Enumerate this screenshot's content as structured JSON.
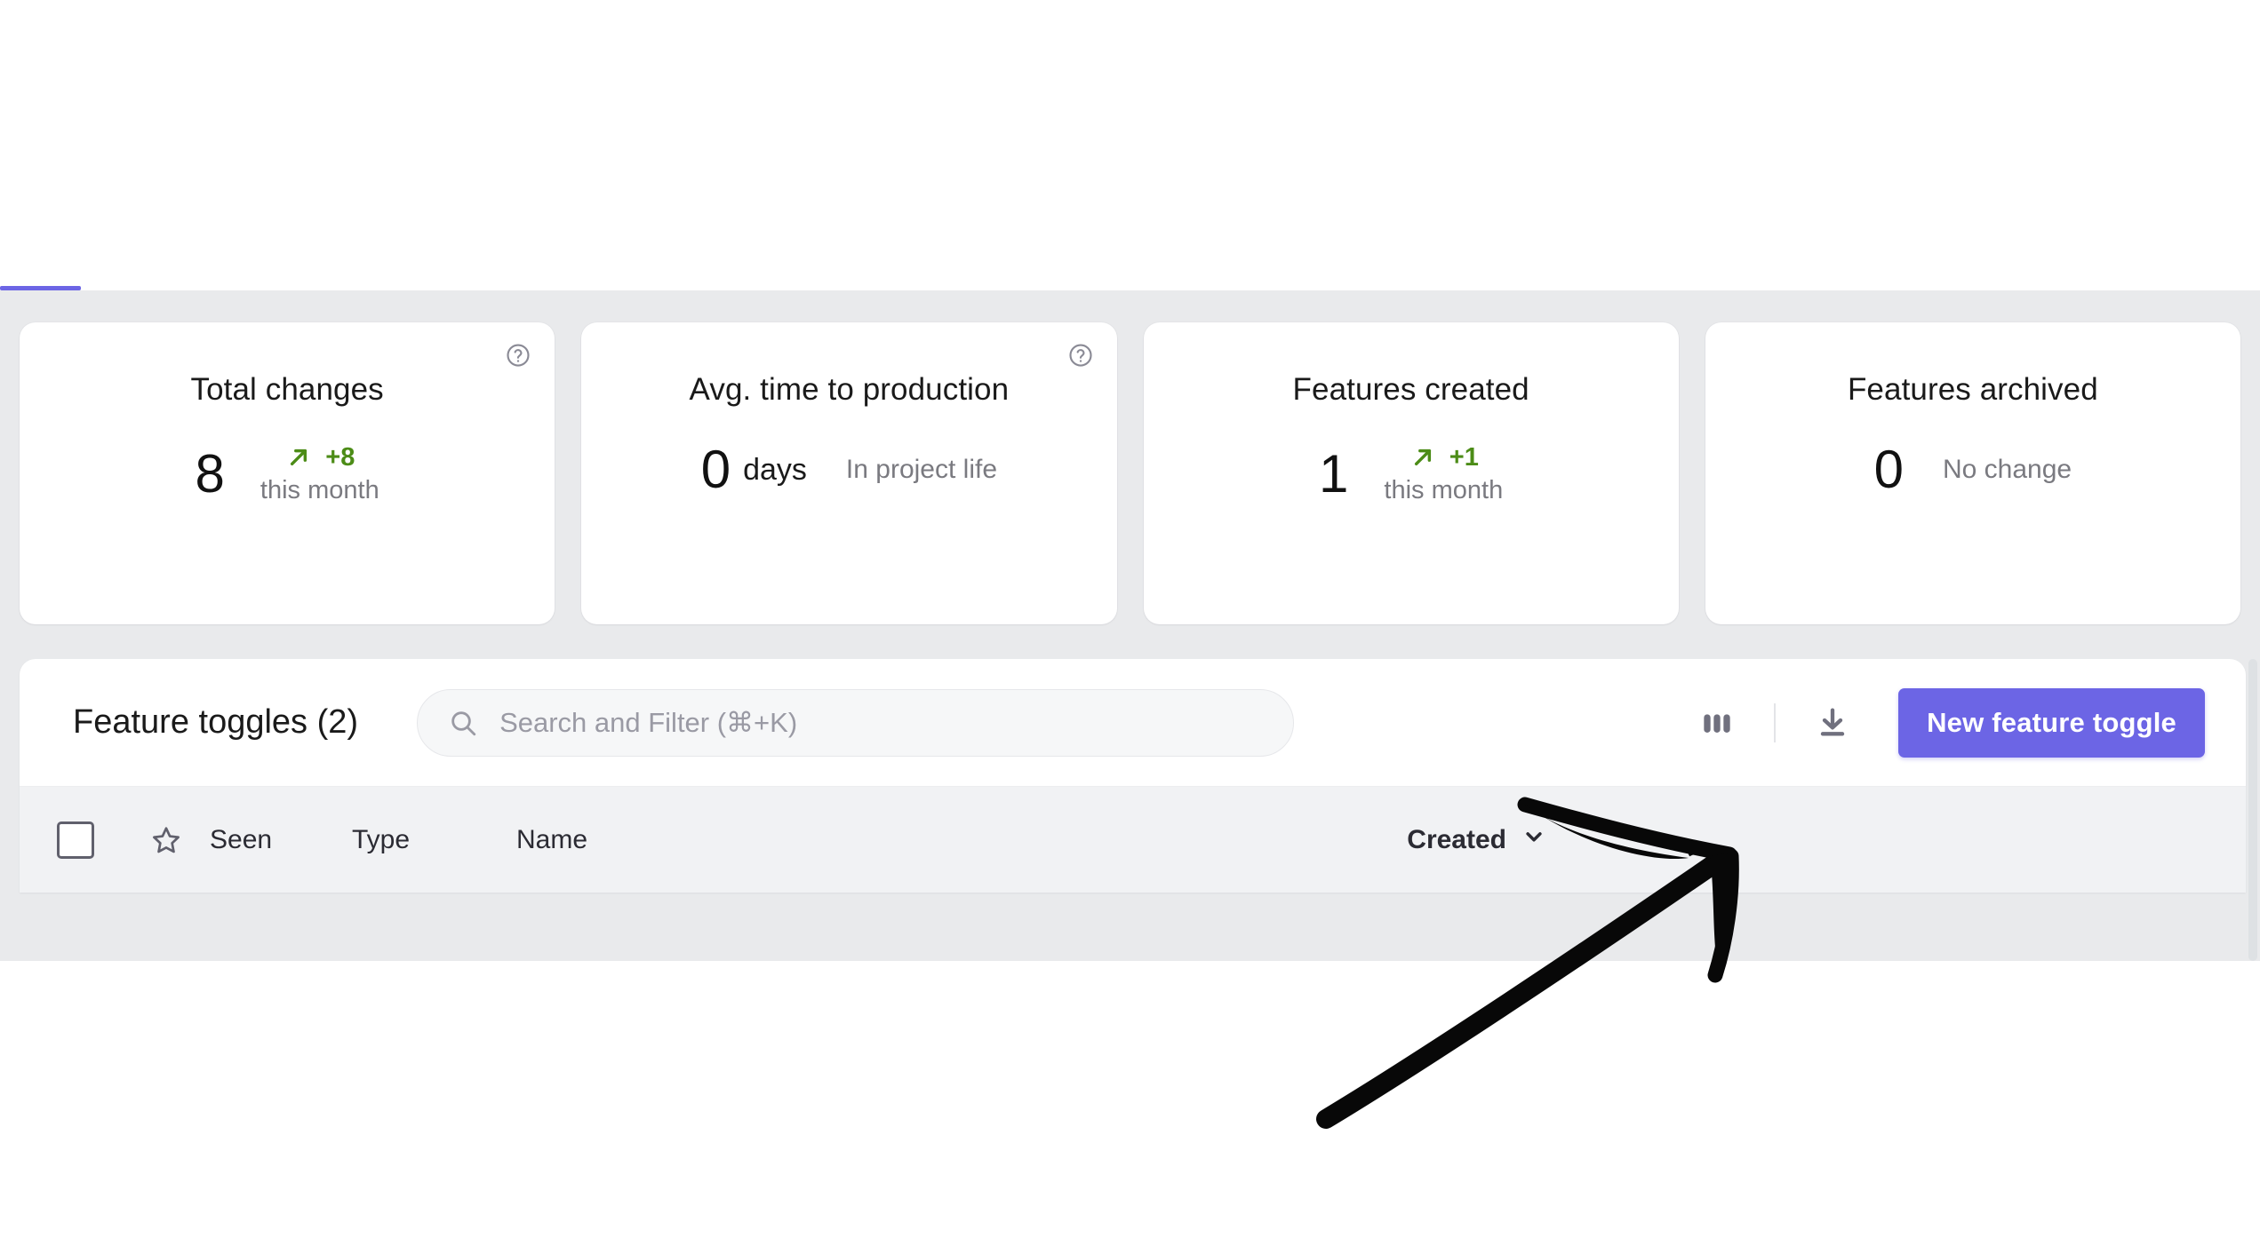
{
  "stats": {
    "cards": [
      {
        "title": "Total changes",
        "value": "8",
        "unit": "",
        "delta": "+8",
        "period": "this month",
        "sub": "",
        "help_icon": "help-circle-icon",
        "trend": "up"
      },
      {
        "title": "Avg. time to production",
        "value": "0",
        "unit": "days",
        "delta": "",
        "period": "",
        "sub": "In project life",
        "help_icon": "help-circle-icon",
        "trend": "none"
      },
      {
        "title": "Features created",
        "value": "1",
        "unit": "",
        "delta": "+1",
        "period": "this month",
        "sub": "",
        "help_icon": "",
        "trend": "up"
      },
      {
        "title": "Features archived",
        "value": "0",
        "unit": "",
        "delta": "",
        "period": "",
        "sub": "No change",
        "help_icon": "",
        "trend": "none"
      }
    ]
  },
  "panel": {
    "title": "Feature toggles (2)",
    "search": {
      "placeholder": "Search and Filter (⌘+K)",
      "value": "",
      "icon": "search-icon"
    },
    "actions": {
      "columns_icon": "columns-icon",
      "export_icon": "download-icon",
      "new_toggle_label": "New feature toggle"
    }
  },
  "table": {
    "select_all": "",
    "star_icon": "star-icon",
    "columns": [
      {
        "label": "Seen",
        "sorted": false
      },
      {
        "label": "Type",
        "sorted": false
      },
      {
        "label": "Name",
        "sorted": false
      },
      {
        "label": "Created",
        "sorted": true
      }
    ],
    "sort_icon": "chevron-down-icon",
    "rows": []
  },
  "annotation": {
    "type": "hand-drawn-arrow",
    "points_to": "New feature toggle",
    "color": "#000000"
  },
  "colors": {
    "accent": "#6C65E5",
    "positive": "#4C8C17",
    "page_bg": "#e9eaec",
    "panel_bg": "#ffffff",
    "table_header_bg": "#f1f2f4",
    "muted_text": "#7a7a80"
  }
}
